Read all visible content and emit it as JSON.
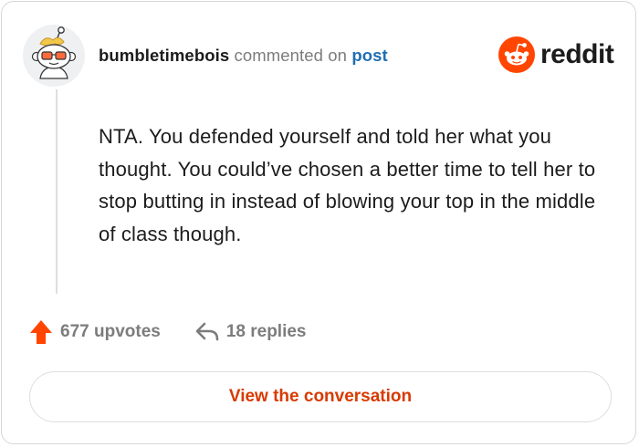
{
  "comment": {
    "username": "bumbletimebois",
    "action_text": "commented on",
    "post_link_label": "post",
    "body": "NTA. You defended yourself and told her what you thought. You could’ve chosen a better time to tell her to stop butting in instead of blowing your top in the middle of class though."
  },
  "brand": {
    "wordmark": "reddit",
    "icon": "reddit-logo-icon",
    "color": "#ff4500"
  },
  "stats": {
    "upvotes_label": "677 upvotes",
    "upvote_icon": "upvote-arrow-icon",
    "replies_label": "18 replies",
    "reply_icon": "reply-arrow-icon"
  },
  "cta": {
    "label": "View the conversation",
    "color": "#d93a00"
  },
  "avatar": {
    "icon": "snoo-avatar-icon"
  }
}
